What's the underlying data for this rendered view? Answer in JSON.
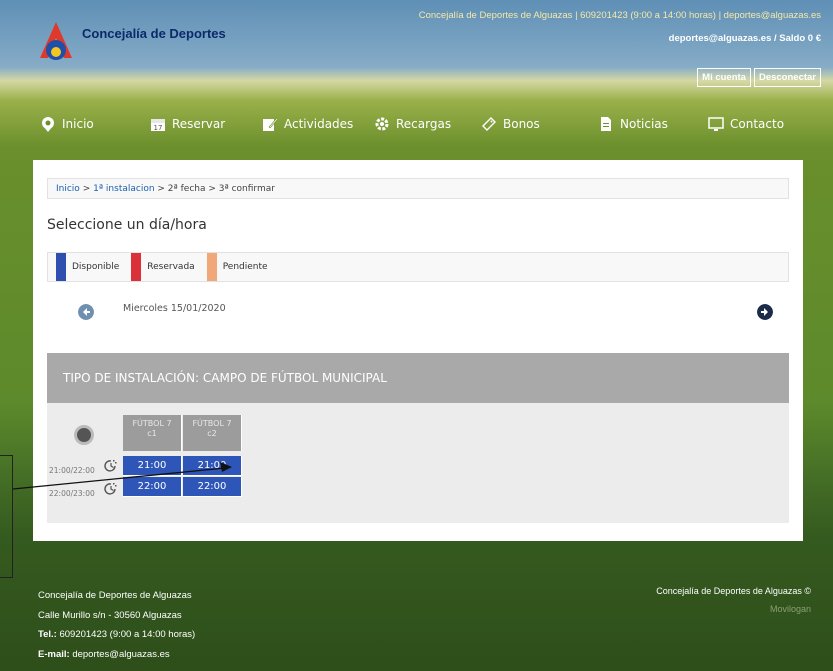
{
  "header": {
    "brand_title": "Concejalía de Deportes",
    "contact_line": "Concejalía de Deportes de Alguazas | 609201423 (9:00 a 14:00 horas) | deportes@alguazas.es",
    "account_line": "deportes@alguazas.es / Saldo 0 €",
    "my_account": "Mi cuenta",
    "logout": "Desconectar"
  },
  "nav": {
    "items": [
      {
        "label": "Inicio",
        "icon": "map-pin-icon"
      },
      {
        "label": "Reservar",
        "icon": "calendar-icon"
      },
      {
        "label": "Actividades",
        "icon": "edit-icon"
      },
      {
        "label": "Recargas",
        "icon": "gear-icon"
      },
      {
        "label": "Bonos",
        "icon": "ticket-icon"
      },
      {
        "label": "Noticias",
        "icon": "document-icon"
      },
      {
        "label": "Contacto",
        "icon": "monitor-icon"
      }
    ]
  },
  "breadcrumb": {
    "home": "Inicio",
    "sep1": " > ",
    "step1": "1ª instalacion",
    "rest": " > 2ª fecha > 3ª confirmar"
  },
  "page_title": "Seleccione un día/hora",
  "legend": {
    "items": [
      {
        "label": "Disponible",
        "color": "#2e4fb0"
      },
      {
        "label": "Reservada",
        "color": "#d9303a"
      },
      {
        "label": "Pendiente",
        "color": "#f0a878"
      }
    ]
  },
  "date_nav": {
    "date": "Miercoles 15/01/2020"
  },
  "facility": {
    "type_title": "TIPO DE INSTALACIÓN: CAMPO DE FÚTBOL MUNICIPAL",
    "columns": [
      {
        "line1": "FÚTBOL 7",
        "line2": "c1"
      },
      {
        "line1": "FÚTBOL 7",
        "line2": "c2"
      }
    ],
    "rows": [
      {
        "time_range": "21:00/22:00",
        "slots": [
          "21:00",
          "21:00"
        ]
      },
      {
        "time_range": "22:00/23:00",
        "slots": [
          "22:00",
          "22:00"
        ]
      }
    ]
  },
  "footer": {
    "org": "Concejalía de Deportes de Alguazas",
    "address": "Calle Murillo s/n - 30560 Alguazas",
    "tel_label": "Tel.:",
    "tel_value": " 609201423 (9:00 a 14:00 horas)",
    "email_label": "E-mail:",
    "email_value": " deportes@alguazas.es",
    "copyright": "Concejalía de Deportes de Alguazas ©",
    "powered": "Movilogan"
  },
  "colors": {
    "available": "#2e55b8",
    "header_bar": "#a9a9a9"
  }
}
